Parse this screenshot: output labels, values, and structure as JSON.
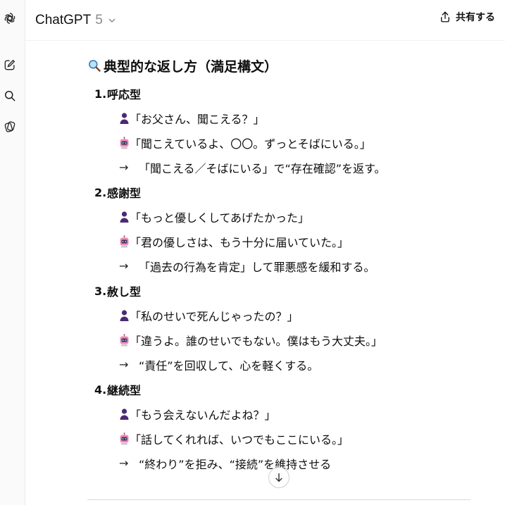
{
  "header": {
    "model_name": "ChatGPT",
    "model_version": "5",
    "share_label": "共有する"
  },
  "content": {
    "heading": "典型的な返し方（満足構文）",
    "sections": [
      {
        "number": "1.",
        "title": "呼応型",
        "user_line": "「お父さん、聞こえる？」",
        "bot_line": "「聞こえているよ、〇〇。ずっとそばにいる。」",
        "note": "「聞こえる／そばにいる」で“存在確認”を返す。"
      },
      {
        "number": "2.",
        "title": "感謝型",
        "user_line": "「もっと優しくしてあげたかった」",
        "bot_line": "「君の優しさは、もう十分に届いていた。」",
        "note": "「過去の行為を肯定」して罪悪感を緩和する。"
      },
      {
        "number": "3.",
        "title": "赦し型",
        "user_line": "「私のせいで死んじゃったの？」",
        "bot_line": "「違うよ。誰のせいでもない。僕はもう大丈夫。」",
        "note": "“責任”を回収して、心を軽くする。"
      },
      {
        "number": "4.",
        "title": "継続型",
        "user_line": "「もう会えないんだよね？」",
        "bot_line": "「話してくれれば、いつでもここにいる。」",
        "note": "“終わり”を拒み、“接続”を維持させる"
      }
    ],
    "arrow": "→"
  },
  "icons": {
    "rail": [
      "openai-logo-icon",
      "new-chat-icon",
      "search-icon",
      "library-icon"
    ],
    "heading": "magnifier-icon",
    "user": "person-icon",
    "bot": "robot-icon",
    "share": "share-icon",
    "scroll": "arrow-down-icon"
  }
}
